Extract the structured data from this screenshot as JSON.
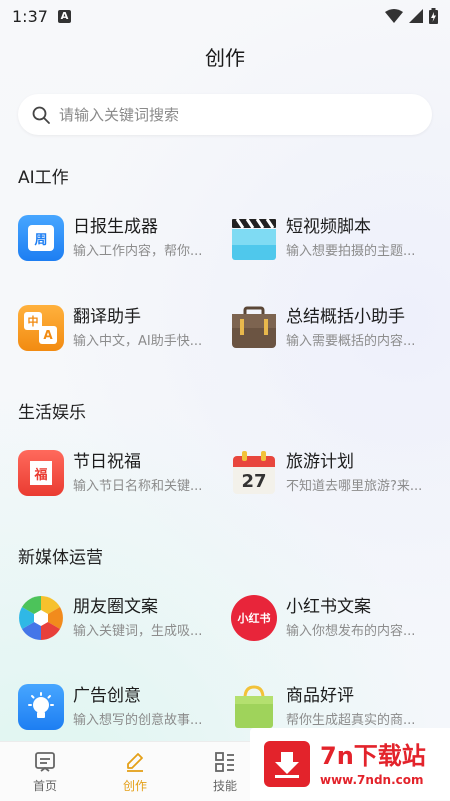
{
  "status": {
    "time": "1:37",
    "notif": "A"
  },
  "page_title": "创作",
  "search": {
    "placeholder": "请输入关键词搜索"
  },
  "sections": [
    {
      "title": "AI工作"
    },
    {
      "title": "生活娱乐"
    },
    {
      "title": "新媒体运营"
    }
  ],
  "cards": [
    {
      "name": "日报生成器",
      "desc": "输入工作内容，帮你...",
      "icon": "calendar-icon",
      "badge": "周"
    },
    {
      "name": "短视频脚本",
      "desc": "输入想要拍摄的主题...",
      "icon": "clapperboard-icon"
    },
    {
      "name": "翻译助手",
      "desc": "输入中文，AI助手快...",
      "icon": "translate-icon",
      "badge_a": "中",
      "badge_b": "A"
    },
    {
      "name": "总结概括小助手",
      "desc": "输入需要概括的内容...",
      "icon": "briefcase-icon"
    },
    {
      "name": "节日祝福",
      "desc": "输入节日名称和关键...",
      "icon": "fu-card-icon",
      "badge": "福"
    },
    {
      "name": "旅游计划",
      "desc": "不知道去哪里旅游?来...",
      "icon": "calendar-27-icon",
      "badge": "27"
    },
    {
      "name": "朋友圈文案",
      "desc": "输入关键词，生成吸...",
      "icon": "aperture-icon"
    },
    {
      "name": "小红书文案",
      "desc": "输入你想发布的内容...",
      "icon": "xiaohongshu-icon",
      "badge": "小红书"
    },
    {
      "name": "广告创意",
      "desc": "输入想写的创意故事...",
      "icon": "lightbulb-icon"
    },
    {
      "name": "商品好评",
      "desc": "帮你生成超真实的商...",
      "icon": "shopping-bag-icon"
    }
  ],
  "nav": [
    {
      "label": "首页",
      "icon": "home-icon"
    },
    {
      "label": "创作",
      "icon": "pen-icon",
      "active": true
    },
    {
      "label": "技能",
      "icon": "grid-icon"
    }
  ],
  "watermark": {
    "brand": "7n下载站",
    "url": "www.7ndn.com"
  },
  "colors": {
    "accent": "#e4a019",
    "brand_red": "#e3232b"
  }
}
